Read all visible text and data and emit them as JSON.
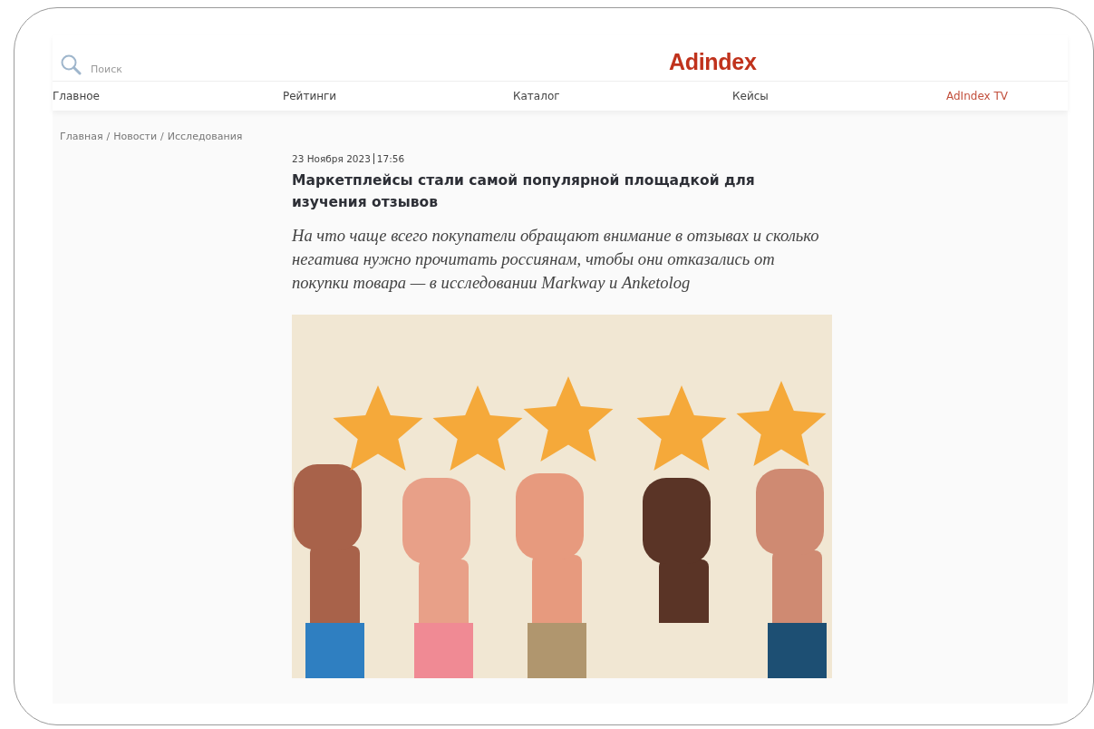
{
  "header": {
    "search": {
      "placeholder": "Поиск"
    },
    "logo": "Adindex"
  },
  "nav": [
    {
      "label": "Главное",
      "selected": false
    },
    {
      "label": "Рейтинги",
      "selected": false
    },
    {
      "label": "Каталог",
      "selected": false
    },
    {
      "label": "Кейсы",
      "selected": false
    },
    {
      "label": "AdIndex TV",
      "selected": true
    }
  ],
  "breadcrumbs": {
    "separator": "/",
    "items": [
      "Главная",
      "Новости",
      "Исследования"
    ]
  },
  "article": {
    "date": "23 Ноября 2023",
    "time": "17:56",
    "title": "Маркетплейсы стали самой популярной площадкой для изучения отзывов",
    "lead": "На что чаще всего покупатели обращают внимание в отзывах и сколько негатива нужно прочитать россиянам, чтобы они отказались от покупки товара — в исследовании Markway и Anketolog"
  }
}
